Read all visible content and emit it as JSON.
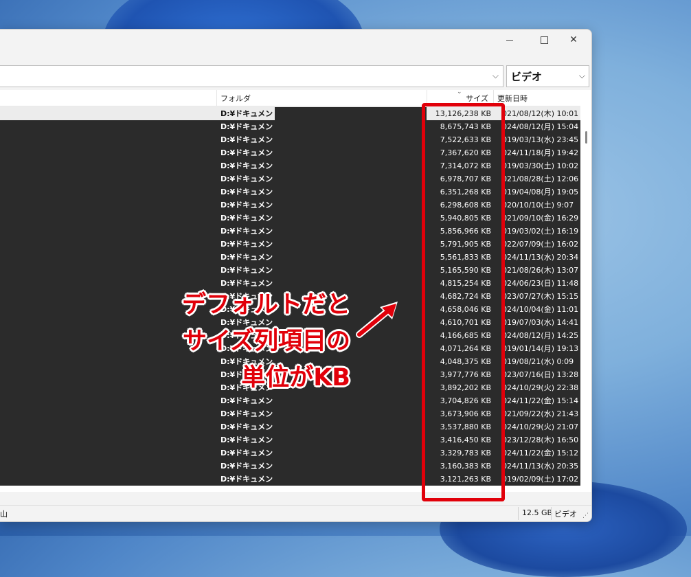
{
  "filter": {
    "value": "ビデオ"
  },
  "columns": {
    "folder": "フォルダ",
    "size": "サイズ",
    "date": "更新日時"
  },
  "rows": [
    {
      "folder": "D:¥ドキュメント¥",
      "size": "13,126,238 KB",
      "date": "021/08/12(木) 10:01",
      "selected": true
    },
    {
      "folder": "D:¥ドキュメント¥",
      "size": "8,675,743 KB",
      "date": "024/08/12(月) 15:04"
    },
    {
      "folder": "D:¥ドキュメント¥",
      "size": "7,522,633 KB",
      "date": "019/03/13(水) 23:45"
    },
    {
      "folder": "D:¥ドキュメント¥",
      "size": "7,367,620 KB",
      "date": "024/11/18(月) 19:42"
    },
    {
      "folder": "D:¥ドキュメント¥",
      "size": "7,314,072 KB",
      "date": "019/03/30(土) 10:02"
    },
    {
      "folder": "D:¥ドキュメント¥",
      "size": "6,978,707 KB",
      "date": "021/08/28(土) 12:06"
    },
    {
      "folder": "D:¥ドキュメント¥",
      "size": "6,351,268 KB",
      "date": "019/04/08(月) 19:05"
    },
    {
      "folder": "D:¥ドキュメント¥",
      "size": "6,298,608 KB",
      "date": "020/10/10(土) 9:07"
    },
    {
      "folder": "D:¥ドキュメント¥",
      "size": "5,940,805 KB",
      "date": "021/09/10(金) 16:29"
    },
    {
      "folder": "D:¥ドキュメント¥",
      "size": "5,856,966 KB",
      "date": "019/03/02(土) 16:19"
    },
    {
      "folder": "D:¥ドキュメント¥",
      "size": "5,791,905 KB",
      "date": "022/07/09(土) 16:02"
    },
    {
      "folder": "D:¥ドキュメント¥",
      "size": "5,561,833 KB",
      "date": "024/11/13(水) 20:34"
    },
    {
      "folder": "D:¥ドキュメント¥",
      "size": "5,165,590 KB",
      "date": "021/08/26(木) 13:07"
    },
    {
      "folder": "D:¥ドキュメント¥",
      "size": "4,815,254 KB",
      "date": "024/06/23(日) 11:48"
    },
    {
      "folder": "D:¥ドキュメント¥",
      "size": "4,682,724 KB",
      "date": "023/07/27(木) 15:15"
    },
    {
      "folder": "D:¥ドキュメント¥",
      "size": "4,658,046 KB",
      "date": "024/10/04(金) 11:01"
    },
    {
      "folder": "D:¥ドキュメント¥",
      "size": "4,610,701 KB",
      "date": "019/07/03(水) 14:41"
    },
    {
      "folder": "D:¥ドキュメント¥",
      "size": "4,166,685 KB",
      "date": "024/08/12(月) 14:25"
    },
    {
      "folder": "D:¥ドキュメント¥",
      "size": "4,071,264 KB",
      "date": "019/01/14(月) 19:13"
    },
    {
      "folder": "D:¥ドキュメント¥",
      "size": "4,048,375 KB",
      "date": "019/08/21(水) 0:09"
    },
    {
      "folder": "D:¥ドキュメント¥",
      "size": "3,977,776 KB",
      "date": "023/07/16(日) 13:28"
    },
    {
      "folder": "D:¥ドキュメント¥",
      "size": "3,892,202 KB",
      "date": "024/10/29(火) 22:38"
    },
    {
      "folder": "D:¥ドキュメント¥",
      "size": "3,704,826 KB",
      "date": "024/11/22(金) 15:14"
    },
    {
      "folder": "D:¥ドキュメント¥",
      "size": "3,673,906 KB",
      "date": "021/09/22(水) 21:43"
    },
    {
      "folder": "D:¥ドキュメント¥",
      "size": "3,537,880 KB",
      "date": "024/10/29(火) 21:07"
    },
    {
      "folder": "D:¥ドキュメント¥",
      "size": "3,416,450 KB",
      "date": "023/12/28(木) 16:50"
    },
    {
      "folder": "D:¥ドキュメント¥",
      "size": "3,329,783 KB",
      "date": "024/11/22(金) 15:12"
    },
    {
      "folder": "D:¥ドキュメント¥",
      "size": "3,160,383 KB",
      "date": "024/11/13(水) 20:35"
    },
    {
      "folder": "D:¥ドキュメント¥",
      "size": "3,121,263 KB",
      "date": "019/02/09(土) 17:02"
    }
  ],
  "status": {
    "left": "山",
    "total": "12.5 GB",
    "type": "ビデオ"
  },
  "annotation": {
    "lines": [
      "デフォルトだと",
      "サイズ列項目の",
      "単位がKB"
    ],
    "color": "#e1000a"
  },
  "icons": {
    "minimize": "minimize-icon",
    "maximize": "maximize-icon",
    "close": "close-icon",
    "dropdown": "chevron-down-icon"
  }
}
